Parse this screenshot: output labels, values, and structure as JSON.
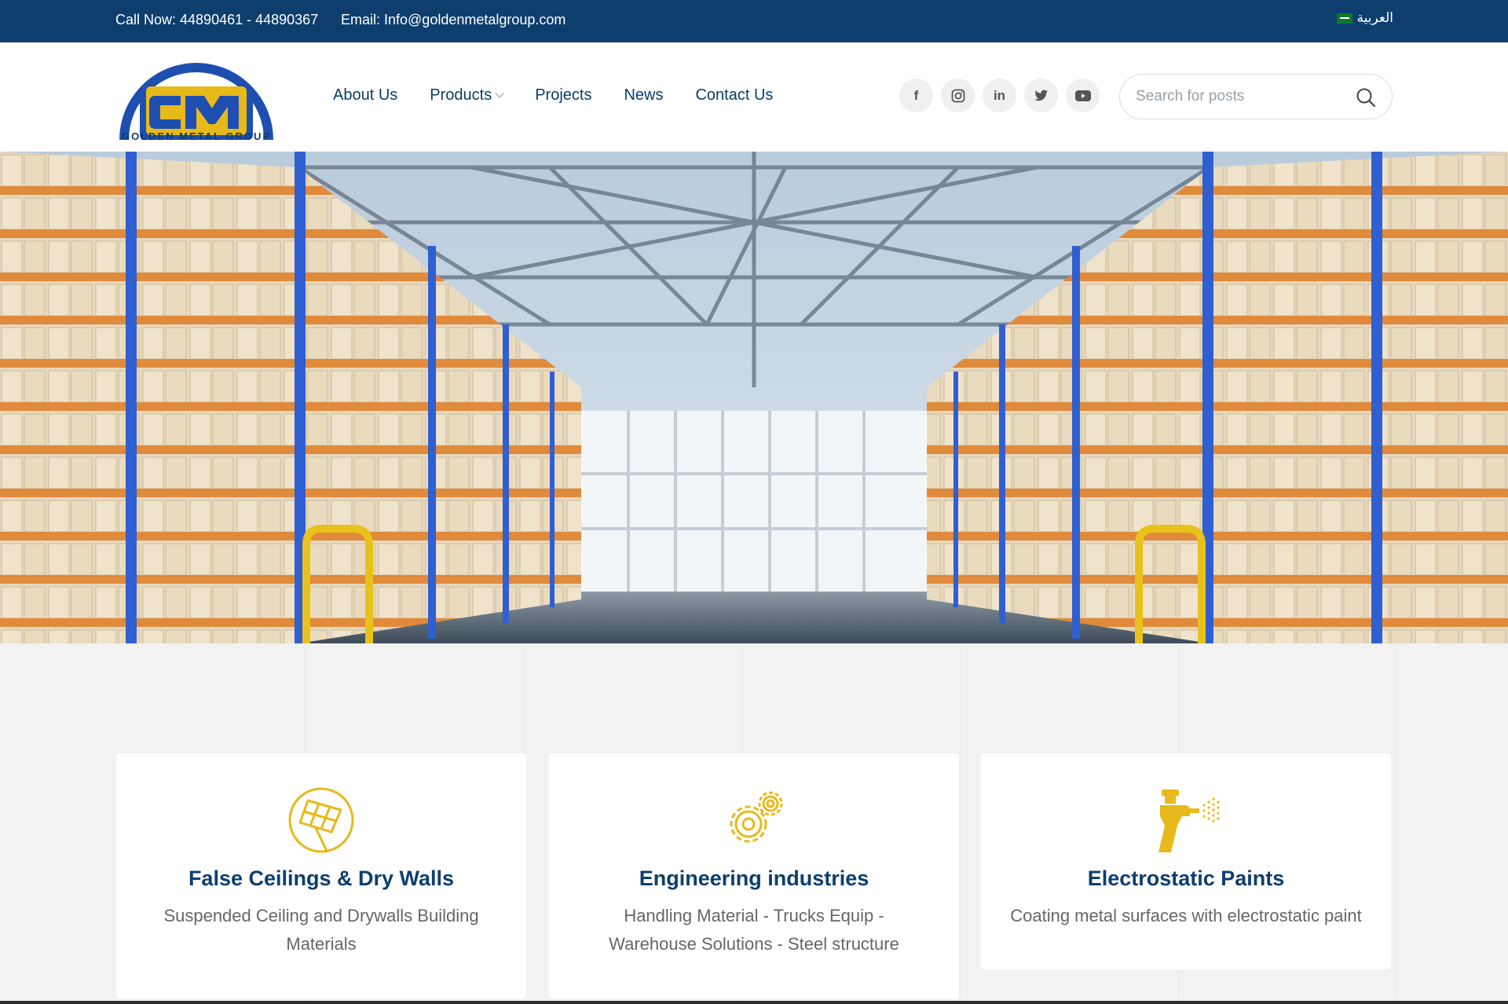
{
  "topbar": {
    "call": "Call Now: 44890461 - 44890367",
    "email": "Email: Info@goldenmetalgroup.com",
    "language": "العربية"
  },
  "header": {
    "logo_text": "GOLDEN METAL GROUP",
    "nav": [
      {
        "label": "About Us"
      },
      {
        "label": "Products"
      },
      {
        "label": "Projects"
      },
      {
        "label": "News"
      },
      {
        "label": "Contact Us"
      }
    ],
    "socials": [
      "facebook-icon",
      "instagram-icon",
      "linkedin-icon",
      "twitter-icon",
      "youtube-icon"
    ],
    "search": {
      "placeholder": "Search for posts"
    }
  },
  "cards": [
    {
      "title": "False Ceilings & Dry Walls",
      "desc": "Suspended Ceiling and Drywalls Building Materials",
      "icon": "ceiling-grid-icon"
    },
    {
      "title": "Engineering industries",
      "desc": "Handling Material - Trucks Equip - Warehouse Solutions - Steel structure",
      "icon": "gears-icon"
    },
    {
      "title": "Electrostatic Paints",
      "desc": "Coating metal surfaces with electrostatic paint",
      "icon": "spray-gun-icon"
    }
  ],
  "colors": {
    "brand_navy": "#0d3e6e",
    "accent_gold": "#e8b91a",
    "rack_blue": "#2f5fd0",
    "rack_orange": "#e08a3c"
  }
}
